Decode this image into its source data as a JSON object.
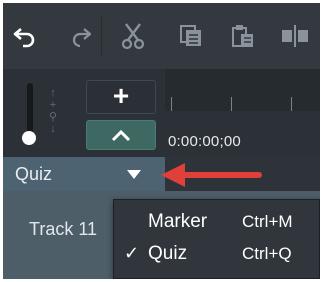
{
  "toolbar": {
    "buttons": [
      {
        "name": "undo",
        "icon": "undo-icon"
      },
      {
        "name": "redo",
        "icon": "redo-icon"
      },
      {
        "name": "cut",
        "icon": "scissors-icon"
      },
      {
        "name": "copy",
        "icon": "copy-icon"
      },
      {
        "name": "paste",
        "icon": "paste-icon"
      },
      {
        "name": "split",
        "icon": "split-icon"
      }
    ]
  },
  "zoom": {
    "plus_label": "+",
    "fit_icon": "chevron-up-icon",
    "slider_icon": "zoom-slider-icon"
  },
  "timeline": {
    "timecode": "0:00:00;00"
  },
  "quiz_track": {
    "label": "Quiz",
    "dropdown_icon": "caret-down-icon"
  },
  "track": {
    "label": "Track 11"
  },
  "menu": {
    "items": [
      {
        "label": "Marker",
        "shortcut": "Ctrl+M",
        "checked": false
      },
      {
        "label": "Quiz",
        "shortcut": "Ctrl+Q",
        "checked": true
      }
    ],
    "check_glyph": "✓"
  },
  "annotation": {
    "arrow_color": "#e0403a"
  },
  "colors": {
    "toolbar_bg": "#33393f",
    "quiz_bar": "#4e6371",
    "accent_button": "#3e6862",
    "menu_bg": "#30363c"
  }
}
